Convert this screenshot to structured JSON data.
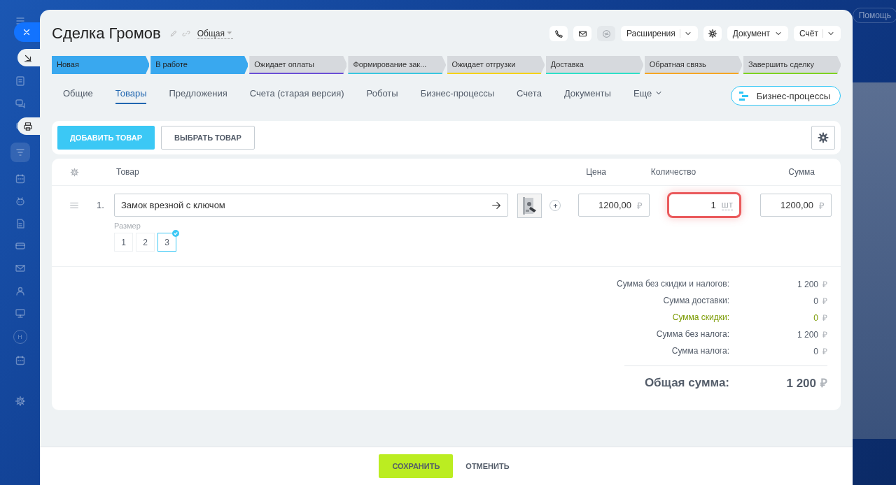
{
  "sidebar": {
    "avatar": "Н"
  },
  "help_button": "Помощь",
  "deal": {
    "title": "Сделка Громов",
    "category": "Общая"
  },
  "header_buttons": {
    "extensions": "Расширения",
    "document": "Документ",
    "invoice": "Счёт"
  },
  "stages": [
    {
      "label": "Новая",
      "reached": true,
      "color": "#39a8ef"
    },
    {
      "label": "В работе",
      "reached": true,
      "color": "#39a8ef"
    },
    {
      "label": "Ожидает оплаты",
      "reached": false,
      "color": "#6b4fd6"
    },
    {
      "label": "Формирование зак...",
      "reached": false,
      "color": "#39c7e0"
    },
    {
      "label": "Ожидает отгрузки",
      "reached": false,
      "color": "#f5d300"
    },
    {
      "label": "Доставка",
      "reached": false,
      "color": "#2fe0c8"
    },
    {
      "label": "Обратная связь",
      "reached": false,
      "color": "#f5a623"
    },
    {
      "label": "Завершить сделку",
      "reached": false,
      "color": "#7ed321"
    }
  ],
  "tabs": [
    {
      "label": "Общие",
      "selected": false,
      "kind": "link"
    },
    {
      "label": "Товары",
      "selected": true,
      "kind": "link"
    },
    {
      "label": "Предложения",
      "selected": false,
      "kind": "link"
    },
    {
      "label": "Счета (старая версия)",
      "selected": false,
      "kind": "link"
    },
    {
      "label": "Роботы",
      "selected": false,
      "kind": "link"
    },
    {
      "label": "Бизнес-процессы",
      "selected": false,
      "kind": "link"
    },
    {
      "label": "Счета",
      "selected": false,
      "kind": "link"
    },
    {
      "label": "Документы",
      "selected": false,
      "kind": "link"
    },
    {
      "label": "Еще",
      "selected": false,
      "kind": "menu"
    }
  ],
  "bp_button": "Бизнес-процессы",
  "toolbar": {
    "add": "ДОБАВИТЬ ТОВАР",
    "choose": "ВЫБРАТЬ ТОВАР"
  },
  "table": {
    "columns": [
      "Товар",
      "Цена",
      "Количество",
      "Сумма"
    ],
    "rows": [
      {
        "number": "1.",
        "name": "Замок врезной с ключом",
        "property_label": "Размер",
        "options": [
          {
            "label": "1",
            "selected": false
          },
          {
            "label": "2",
            "selected": false
          },
          {
            "label": "3",
            "selected": true
          }
        ],
        "price": "1200,00",
        "price_currency": "₽",
        "quantity": "1",
        "unit": "шт",
        "quantity_invalid": true,
        "sum": "1200,00",
        "sum_currency": "₽"
      }
    ]
  },
  "totals": [
    {
      "label": "Сумма без скидки и налогов:",
      "value": "1 200",
      "currency": "₽",
      "kind": "normal"
    },
    {
      "label": "Сумма доставки:",
      "value": "0",
      "currency": "₽",
      "kind": "normal"
    },
    {
      "label": "Сумма скидки:",
      "value": "0",
      "currency": "₽",
      "kind": "discount"
    },
    {
      "label": "Сумма без налога:",
      "value": "1 200",
      "currency": "₽",
      "kind": "normal"
    },
    {
      "label": "Сумма налога:",
      "value": "0",
      "currency": "₽",
      "kind": "normal"
    }
  ],
  "grand_total": {
    "label": "Общая сумма:",
    "value": "1 200",
    "currency": "₽"
  },
  "footer": {
    "save": "СОХРАНИТЬ",
    "cancel": "ОТМЕНИТЬ"
  }
}
